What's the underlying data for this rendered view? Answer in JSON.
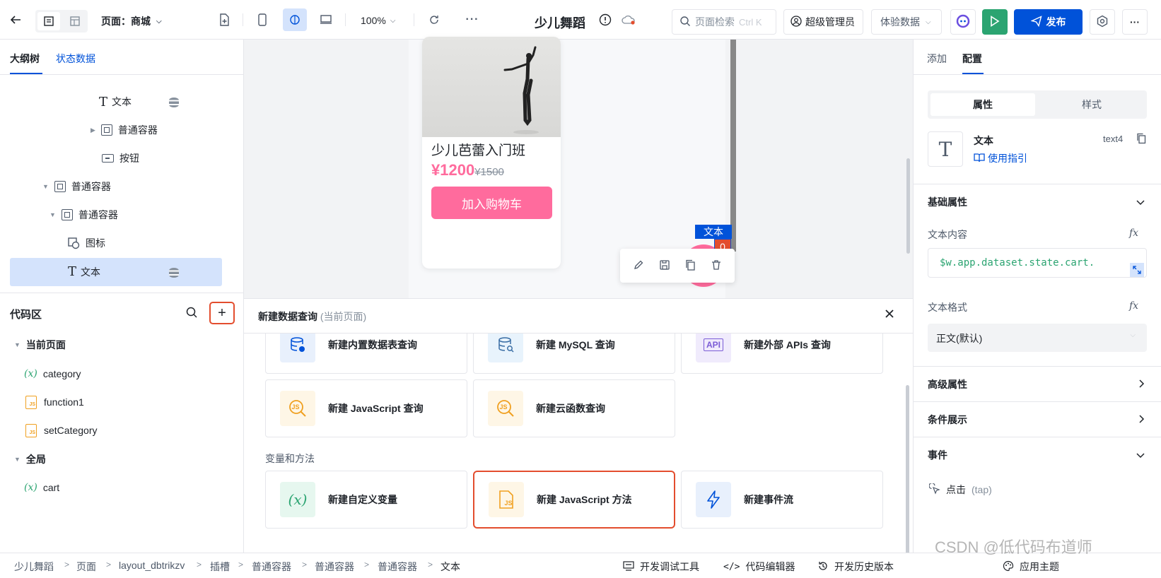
{
  "topbar": {
    "page_label": "页面：商城",
    "zoom": "100%",
    "app_title": "少儿舞蹈",
    "search_placeholder": "页面检索",
    "search_shortcut": "Ctrl K",
    "admin_label": "超级管理员",
    "data_select": "体验数据",
    "publish_label": "发布"
  },
  "left": {
    "tabs": [
      "大纲树",
      "状态数据"
    ],
    "tree": [
      {
        "label": "文本",
        "icon": "text-icon"
      },
      {
        "label": "普通容器",
        "icon": "container-icon"
      },
      {
        "label": "按钮",
        "icon": "button-icon"
      },
      {
        "label": "普通容器",
        "icon": "container-icon"
      },
      {
        "label": "普通容器",
        "icon": "container-icon"
      },
      {
        "label": "图标",
        "icon": "icon-component-icon"
      },
      {
        "label": "文本",
        "icon": "text-icon"
      }
    ],
    "code_title": "代码区",
    "groups": {
      "current": "当前页面",
      "global": "全局"
    },
    "code_items": [
      {
        "label": "category",
        "type": "variable"
      },
      {
        "label": "function1",
        "type": "js"
      },
      {
        "label": "setCategory",
        "type": "js"
      },
      {
        "label": "cart",
        "type": "variable"
      }
    ]
  },
  "canvas": {
    "product_title": "少儿芭蕾入门班",
    "price": "¥1200",
    "old_price": "¥1500",
    "cart_button": "加入购物车",
    "tag_label": "文本",
    "badge": "0"
  },
  "query": {
    "title": "新建数据查询",
    "scope": "(当前页面)",
    "cards_row1": [
      "新建内置数据表查询",
      "新建 MySQL 查询",
      "新建外部 APIs 查询"
    ],
    "cards_row2": [
      "新建 JavaScript 查询",
      "新建云函数查询"
    ],
    "section_label": "变量和方法",
    "cards_row3": [
      "新建自定义变量",
      "新建 JavaScript 方法",
      "新建事件流"
    ],
    "icon_text": {
      "api": "API",
      "js": "JS",
      "var": "(x)"
    }
  },
  "right": {
    "tabs": [
      "添加",
      "配置"
    ],
    "segments": [
      "属性",
      "样式"
    ],
    "component_name": "文本",
    "component_id": "text4",
    "guide_link": "使用指引",
    "basic_props": "基础属性",
    "text_content_label": "文本内容",
    "text_content_value": "$w.app.dataset.state.cart.",
    "text_format_label": "文本格式",
    "text_format_value": "正文(默认)",
    "advanced": "高级属性",
    "condition": "条件展示",
    "events": "事件",
    "event_item": "点击",
    "event_item_sub": "(tap)",
    "fx": "fx"
  },
  "bottom": {
    "crumbs": [
      "少儿舞蹈",
      "页面",
      "layout_dbtrikzv",
      "插槽",
      "普通容器",
      "普通容器",
      "普通容器",
      "文本"
    ],
    "dev_tools": "开发调试工具",
    "code_editor": "代码编辑器",
    "history": "开发历史版本",
    "theme": "应用主题",
    "watermark": "CSDN @低代码布道师"
  },
  "colors": {
    "primary": "#0052d9",
    "pink": "#ff6b9d",
    "green": "#2ba471",
    "red": "#e34d2e"
  }
}
